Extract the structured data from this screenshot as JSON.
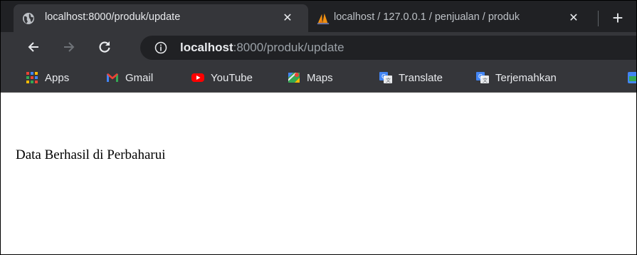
{
  "tabs": [
    {
      "title": "localhost:8000/produk/update",
      "close": "✕",
      "active": true
    },
    {
      "title": "localhost / 127.0.0.1 / penjualan / produk",
      "close": "✕",
      "active": false
    }
  ],
  "newtab_glyph": "+",
  "omnibox": {
    "host": "localhost",
    "rest": ":8000/produk/update"
  },
  "bookmarks": [
    {
      "label": "Apps",
      "icon": "apps-grid-icon"
    },
    {
      "label": "Gmail",
      "icon": "gmail-icon"
    },
    {
      "label": "YouTube",
      "icon": "youtube-icon"
    },
    {
      "label": "Maps",
      "icon": "maps-icon"
    },
    {
      "label": "Translate",
      "icon": "translate-icon"
    },
    {
      "label": "Terjemahkan",
      "icon": "translate-icon"
    }
  ],
  "page": {
    "message": "Data Berhasil di Perbaharui"
  },
  "colors": {
    "tabstrip": "#202124",
    "toolbar": "#35363a",
    "omnibox": "#202124",
    "text": "#e8eaed"
  }
}
